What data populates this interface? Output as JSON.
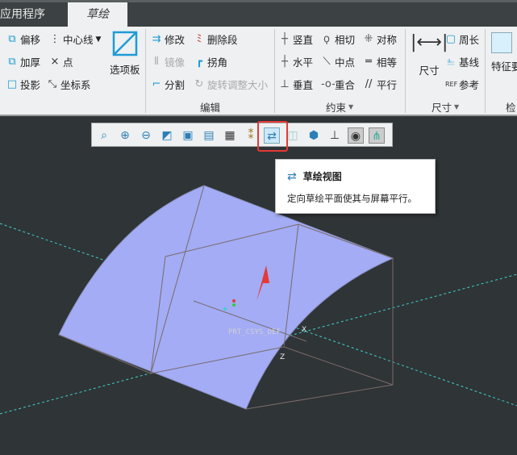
{
  "tabs": [
    "应用程序",
    "草绘"
  ],
  "ribbon": {
    "setup": {
      "offset": "偏移",
      "thicken": "加厚",
      "project": "投影",
      "centerline": "中心线",
      "point": "点",
      "csys": "坐标系",
      "palette": "选项板"
    },
    "edit": {
      "modify": "修改",
      "delete_segment": "删除段",
      "mirror": "镜像",
      "corner": "拐角",
      "divide": "分割",
      "rotate_resize": "旋转调整大小",
      "group": "编辑"
    },
    "constrain": {
      "vertical": "竖直",
      "tangent": "相切",
      "symmetric": "对称",
      "horizontal": "水平",
      "midpoint": "中点",
      "equal": "相等",
      "perpendicular": "垂直",
      "coincident": "重合",
      "parallel": "平行",
      "group": "约束"
    },
    "dimension": {
      "dimension": "尺寸",
      "perimeter": "周长",
      "baseline": "基线",
      "reference": "参考",
      "group": "尺寸"
    },
    "inspect": {
      "feature": "特征要",
      "group": "检"
    }
  },
  "view_toolbar": [
    "refit",
    "zoom-in",
    "zoom-out",
    "repaint",
    "saved-orientations",
    "named-views",
    "display-style",
    "datum-display",
    "sketch-view",
    "hidden-line",
    "shading",
    "annotation-display",
    "sketcher-display",
    "constraint-display"
  ],
  "tooltip": {
    "title": "草绘视图",
    "description": "定向草绘平面使其与屏幕平行。"
  },
  "model": {
    "csys_label": "PRT_CSYS_DEF",
    "axis_x": "X",
    "axis_z": "Z"
  },
  "colors": {
    "accent": "#1e9bd7",
    "highlight": "#e53935",
    "surface": "#a3acf5"
  }
}
